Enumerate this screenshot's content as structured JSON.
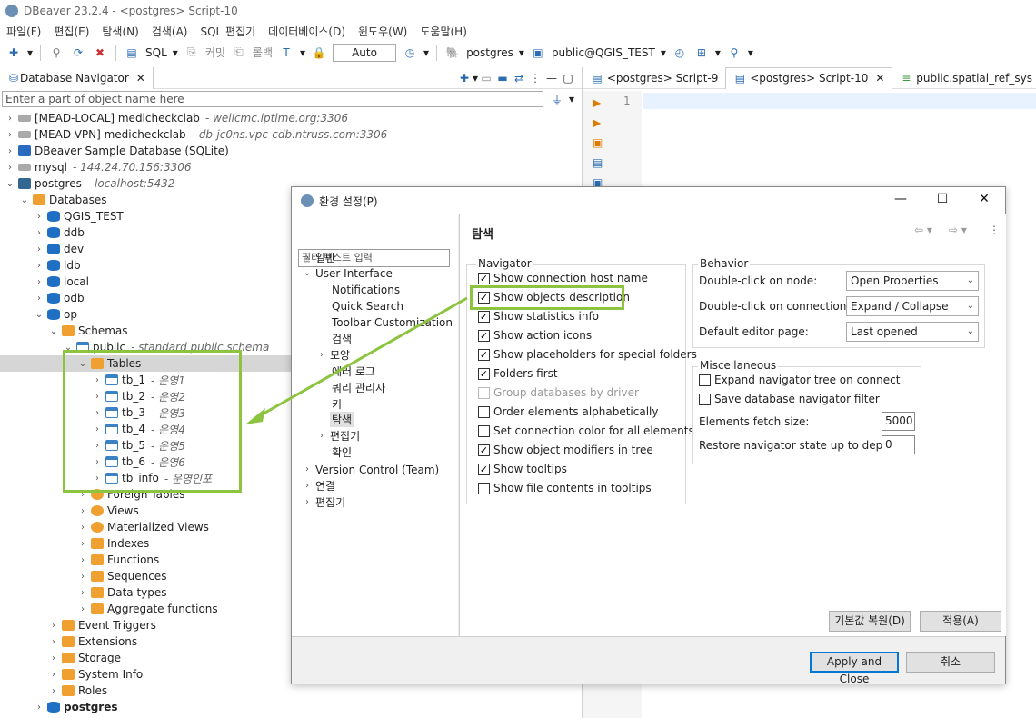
{
  "window": {
    "title": "DBeaver 23.2.4 - <postgres> Script-10"
  },
  "menu": [
    "파일(F)",
    "편집(E)",
    "탐색(N)",
    "검색(A)",
    "SQL 편집기",
    "데이터베이스(D)",
    "윈도우(W)",
    "도움말(H)"
  ],
  "toolbar": {
    "sql_label": "SQL",
    "commit_label": "커밋",
    "rollback_label": "롤백",
    "tx_mode": "Auto",
    "datasource": "postgres",
    "schema": "public@QGIS_TEST"
  },
  "navigator": {
    "tab_label": "Database Navigator",
    "filter_placeholder": "Enter a part of object name here",
    "connections": [
      {
        "name": "[MEAD-LOCAL] medicheckclab",
        "desc": "- wellcmc.iptime.org:3306"
      },
      {
        "name": "[MEAD-VPN] medicheckclab",
        "desc": "- db-jc0ns.vpc-cdb.ntruss.com:3306"
      },
      {
        "name": "DBeaver Sample Database (SQLite)",
        "desc": ""
      },
      {
        "name": "mysql",
        "desc": "- 144.24.70.156:3306"
      },
      {
        "name": "postgres",
        "desc": "- localhost:5432"
      }
    ],
    "databases_label": "Databases",
    "databases": [
      "QGIS_TEST",
      "ddb",
      "dev",
      "ldb",
      "local",
      "odb",
      "op"
    ],
    "schemas_label": "Schemas",
    "public_label": "public",
    "public_desc": "- standard public schema",
    "tables_label": "Tables",
    "tables": [
      {
        "name": "tb_1",
        "desc": "- 운영1"
      },
      {
        "name": "tb_2",
        "desc": "- 운영2"
      },
      {
        "name": "tb_3",
        "desc": "- 운영3"
      },
      {
        "name": "tb_4",
        "desc": "- 운영4"
      },
      {
        "name": "tb_5",
        "desc": "- 운영5"
      },
      {
        "name": "tb_6",
        "desc": "- 운영6"
      },
      {
        "name": "tb_info",
        "desc": "- 운영인포"
      }
    ],
    "schema_children": [
      "Foreign Tables",
      "Views",
      "Materialized Views",
      "Indexes",
      "Functions",
      "Sequences",
      "Data types",
      "Aggregate functions"
    ],
    "db_children": [
      "Event Triggers",
      "Extensions",
      "Storage",
      "System Info",
      "Roles"
    ],
    "last_db": "postgres"
  },
  "editor": {
    "tabs": [
      "<postgres> Script-9",
      "<postgres> Script-10",
      "public.spatial_ref_sys"
    ],
    "line_number": "1"
  },
  "dialog": {
    "title": "환경 설정(P)",
    "filter_placeholder": "필터 텍스트 입력",
    "tree": [
      {
        "label": "일반",
        "level": 0,
        "chev": "›"
      },
      {
        "label": "User Interface",
        "level": 0,
        "chev": "⌄"
      },
      {
        "label": "Notifications",
        "level": 1,
        "chev": ""
      },
      {
        "label": "Quick Search",
        "level": 1,
        "chev": ""
      },
      {
        "label": "Toolbar Customization",
        "level": 1,
        "chev": ""
      },
      {
        "label": "검색",
        "level": 1,
        "chev": ""
      },
      {
        "label": "모양",
        "level": 1,
        "chev": "›"
      },
      {
        "label": "에러 로그",
        "level": 1,
        "chev": ""
      },
      {
        "label": "쿼리 관리자",
        "level": 1,
        "chev": ""
      },
      {
        "label": "키",
        "level": 1,
        "chev": ""
      },
      {
        "label": "탐색",
        "level": 1,
        "chev": ""
      },
      {
        "label": "편집기",
        "level": 1,
        "chev": "›"
      },
      {
        "label": "확인",
        "level": 1,
        "chev": ""
      },
      {
        "label": "Version Control (Team)",
        "level": 0,
        "chev": "›"
      },
      {
        "label": "연결",
        "level": 0,
        "chev": "›"
      },
      {
        "label": "편집기",
        "level": 0,
        "chev": "›"
      }
    ],
    "page_title": "탐색",
    "navigator_group": "Navigator",
    "options": [
      {
        "label": "Show connection host name",
        "checked": true,
        "disabled": false
      },
      {
        "label": "Show objects description",
        "checked": true,
        "disabled": false
      },
      {
        "label": "Show statistics info",
        "checked": true,
        "disabled": false
      },
      {
        "label": "Show action icons",
        "checked": true,
        "disabled": false
      },
      {
        "label": "Show placeholders for special folders",
        "checked": true,
        "disabled": false
      },
      {
        "label": "Folders first",
        "checked": true,
        "disabled": false
      },
      {
        "label": "Group databases by driver",
        "checked": false,
        "disabled": true
      },
      {
        "label": "Order elements alphabetically",
        "checked": false,
        "disabled": false
      },
      {
        "label": "Set connection color for all elements",
        "checked": false,
        "disabled": false
      },
      {
        "label": "Show object modifiers in tree",
        "checked": true,
        "disabled": false
      },
      {
        "label": "Show tooltips",
        "checked": true,
        "disabled": false
      },
      {
        "label": "Show file contents in tooltips",
        "checked": false,
        "disabled": false
      }
    ],
    "behavior_group": "Behavior",
    "behavior": [
      {
        "label": "Double-click on node:",
        "value": "Open Properties"
      },
      {
        "label": "Double-click on connection:",
        "value": "Expand / Collapse"
      },
      {
        "label": "Default editor page:",
        "value": "Last opened"
      }
    ],
    "misc_group": "Miscellaneous",
    "misc_checks": [
      {
        "label": "Expand navigator tree on connect",
        "checked": false
      },
      {
        "label": "Save database navigator filter",
        "checked": false
      }
    ],
    "fetch_label": "Elements fetch size:",
    "fetch_value": "5000",
    "restore_label": "Restore navigator state up to depth:",
    "restore_value": "0",
    "restore_defaults": "기본값 복원(D)",
    "apply": "적용(A)",
    "apply_close": "Apply and Close",
    "cancel": "취소"
  },
  "colors": {
    "highlight": "#8cc43f",
    "accent": "#0078d7"
  }
}
